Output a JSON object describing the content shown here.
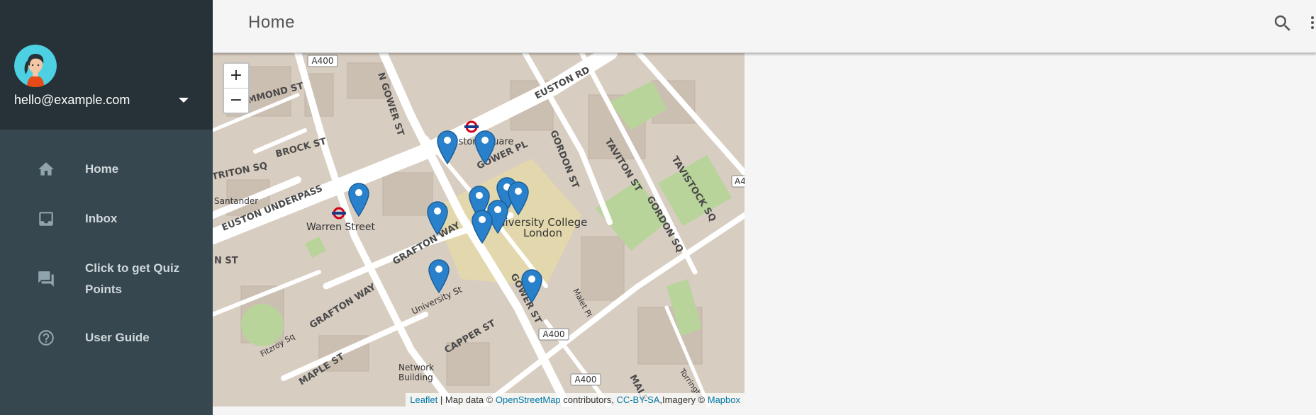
{
  "user": {
    "email": "hello@example.com"
  },
  "nav": [
    {
      "label": "Home",
      "icon": "home-icon"
    },
    {
      "label": "Inbox",
      "icon": "inbox-icon"
    },
    {
      "label": "Click to get Quiz Points",
      "icon": "chat-icon"
    },
    {
      "label": "User Guide",
      "icon": "help-circle-icon"
    }
  ],
  "header": {
    "title": "Home",
    "search_icon": "search-icon",
    "more_icon": "more-vert-icon"
  },
  "map": {
    "zoom_in": "+",
    "zoom_out": "−",
    "labels": {
      "euston_rd": "EUSTON RD",
      "euston_underpass": "EUSTON UNDERPASS",
      "warren_street": "Warren Street",
      "grafton_way": "GRAFTON WAY",
      "grafton_way_2": "GRAFTON WAY",
      "gower_st": "GOWER ST",
      "gower_pl": "GOWER PL",
      "n_gower_st": "N GOWER ST",
      "gordon_st": "GORDON ST",
      "gordon_sq": "GORDON SQ",
      "tavistock_sq": "TAVISTOCK SQ",
      "taviton_st": "TAVITON ST",
      "drummond_st": "DRUMMOND ST",
      "brock_st": "BROCK ST",
      "triton_sq": "TRITON SQ",
      "santander": "Santander",
      "ucl_1": "University College",
      "ucl_2": "London",
      "euston_square": "Euston Square",
      "university_st": "University St",
      "capper_st": "CAPPER ST",
      "maple_st": "MAPLE ST",
      "fitzroy_sq": "Fitzroy Sq",
      "malet_pl": "Malet Pl",
      "network_1": "Network",
      "network_2": "Building",
      "torrington": "Torrington",
      "male": "MALE",
      "n_st": "N ST",
      "a400": "A400",
      "a4": "A4"
    },
    "attribution": {
      "leaflet": "Leaflet",
      "mapdata": " | Map data © ",
      "osm": "OpenStreetMap",
      "contributors": " contributors, ",
      "license": "CC-BY-SA",
      "imagery": ",Imagery © ",
      "mapbox": "Mapbox"
    }
  },
  "colors": {
    "sidebar_bg": "#37474f",
    "sidebar_header_bg": "#263238",
    "avatar_bg": "#4dd0e1",
    "marker": "#2a81cb",
    "link": "#0078a8"
  }
}
